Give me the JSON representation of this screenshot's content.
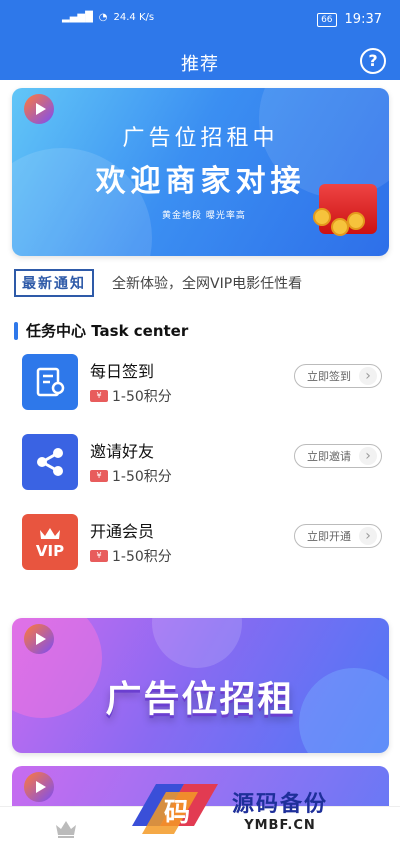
{
  "status_bar": {
    "signal": "⁴⁶.ıll",
    "speed": "24.4\nK/s",
    "battery": "66",
    "time": "19:37"
  },
  "header": {
    "title": "推荐",
    "help_label": "?"
  },
  "banner_top": {
    "line1": "广告位招租中",
    "line2": "欢迎商家对接",
    "line3": "黄金地段  曝光率高"
  },
  "notice": {
    "badge": "最新通知",
    "text": "全新体验，全网VIP电影任性看"
  },
  "task_center": {
    "title": "任务中心 Task center"
  },
  "tasks": [
    {
      "name": "每日签到",
      "reward": "1-50积分",
      "button": "立即签到",
      "icon": "checkin-certificate-icon",
      "color": "#2e78ea"
    },
    {
      "name": "邀请好友",
      "reward": "1-50积分",
      "button": "立即邀请",
      "icon": "share-icon",
      "color": "#3a63e3"
    },
    {
      "name": "开通会员",
      "reward": "1-50积分",
      "button": "立即开通",
      "icon": "vip-crown-icon",
      "color": "#e8553f"
    }
  ],
  "banner_bottom": {
    "text": "广告位招租"
  },
  "watermark": {
    "title": "源码备份",
    "subtitle": "YMBF.CN",
    "char": "码"
  },
  "colors": {
    "primary": "#2e78ea"
  }
}
